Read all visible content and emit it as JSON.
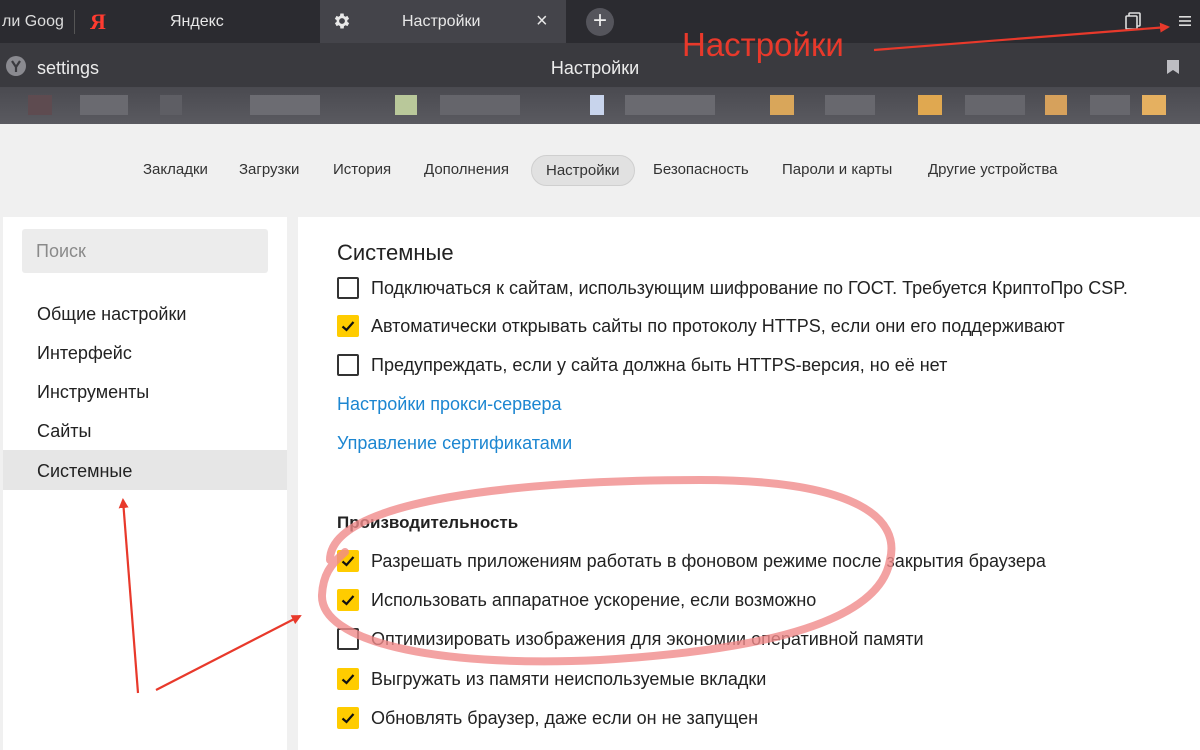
{
  "tabs": {
    "google_label": "ли Goog",
    "yandex_label": "Яндекс",
    "yandex_logo": "Я",
    "active_label": "Настройки",
    "close_glyph": "×",
    "new_tab_glyph": "+"
  },
  "addressbar": {
    "text": "settings",
    "title": "Настройки"
  },
  "topnav": {
    "items": [
      "Закладки",
      "Загрузки",
      "История",
      "Дополнения",
      "Настройки",
      "Безопасность",
      "Пароли и карты",
      "Другие устройства"
    ]
  },
  "sidebar": {
    "search_placeholder": "Поиск",
    "items": [
      "Общие настройки",
      "Интерфейс",
      "Инструменты",
      "Сайты",
      "Системные"
    ]
  },
  "panel": {
    "title": "Системные",
    "rows": [
      {
        "label": "Подключаться к сайтам, использующим шифрование по ГОСТ. Требуется КриптоПро CSP.",
        "checked": false
      },
      {
        "label": "Автоматически открывать сайты по протоколу HTTPS, если они его поддерживают",
        "checked": true
      },
      {
        "label": "Предупреждать, если у сайта должна быть HTTPS-версия, но её нет",
        "checked": false
      }
    ],
    "links": [
      "Настройки прокси-сервера",
      "Управление сертификатами"
    ],
    "section_title": "Производительность",
    "perf_rows": [
      {
        "label": "Разрешать приложениям работать в фоновом режиме после закрытия браузера",
        "checked": true
      },
      {
        "label": "Использовать аппаратное ускорение, если возможно",
        "checked": true
      },
      {
        "label": "Оптимизировать изображения для экономии оперативной памяти",
        "checked": false
      },
      {
        "label": "Выгружать из памяти неиспользуемые вкладки",
        "checked": true
      },
      {
        "label": "Обновлять браузер, даже если он не запущен",
        "checked": true
      }
    ]
  },
  "annotation": {
    "label": "Настройки",
    "color": "#e8392b"
  },
  "colors": {
    "checkbox_on": "#ffcc00",
    "link": "#1c86d1"
  }
}
